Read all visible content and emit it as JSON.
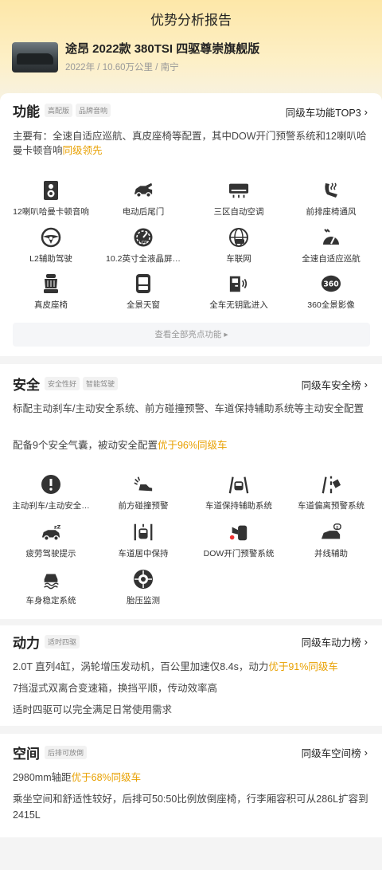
{
  "page_title": "优势分析报告",
  "car": {
    "name": "途昂 2022款 380TSI 四驱尊崇旗舰版",
    "year": "2022年",
    "mileage": "10.60万公里",
    "city": "南宁",
    "sep": "/"
  },
  "function": {
    "title": "功能",
    "tags": [
      "高配版",
      "品牌音响"
    ],
    "rank": "同级车功能TOP3",
    "desc": "主要有：全速自适应巡航、真皮座椅等配置，其中DOW开门预警系统和12喇叭哈曼卡顿音响",
    "hl": "同级领先",
    "items": [
      {
        "label": "12喇叭哈曼卡顿音响",
        "icon": "speaker-icon"
      },
      {
        "label": "电动后尾门",
        "icon": "tailgate-icon"
      },
      {
        "label": "三区自动空调",
        "icon": "air-conditioner-icon"
      },
      {
        "label": "前排座椅通风",
        "icon": "seat-ventilation-icon"
      },
      {
        "label": "L2辅助驾驶",
        "icon": "steering-wheel-icon"
      },
      {
        "label": "10.2英寸全液晶屏…",
        "icon": "lcd-gauge-icon"
      },
      {
        "label": "车联网",
        "icon": "globe-car-icon"
      },
      {
        "label": "全速自适应巡航",
        "icon": "cruise-icon"
      },
      {
        "label": "真皮座椅",
        "icon": "leather-seat-icon"
      },
      {
        "label": "全景天窗",
        "icon": "sunroof-icon"
      },
      {
        "label": "全车无钥匙进入",
        "icon": "keyless-entry-icon"
      },
      {
        "label": "360全景影像",
        "icon": "camera-360-icon"
      }
    ],
    "more": "查看全部亮点功能 ▸"
  },
  "safety": {
    "title": "安全",
    "tags": [
      "安全性好",
      "智能驾驶"
    ],
    "rank": "同级车安全榜",
    "desc": "标配主动刹车/主动安全系统、前方碰撞预警、车道保持辅助系统等主动安全配置",
    "desc2": "配备9个安全气囊，被动安全配置",
    "hl": "优于96%同级车",
    "items": [
      {
        "label": "主动刹车/主动安全…",
        "icon": "brake-warning-icon"
      },
      {
        "label": "前方碰撞预警",
        "icon": "collision-warning-icon"
      },
      {
        "label": "车道保持辅助系统",
        "icon": "lane-keep-icon"
      },
      {
        "label": "车道偏离预警系统",
        "icon": "lane-departure-icon"
      },
      {
        "label": "疲劳驾驶提示",
        "icon": "fatigue-icon"
      },
      {
        "label": "车道居中保持",
        "icon": "lane-center-icon"
      },
      {
        "label": "DOW开门预警系统",
        "icon": "door-warning-icon"
      },
      {
        "label": "并线辅助",
        "icon": "blind-spot-icon"
      },
      {
        "label": "车身稳定系统",
        "icon": "stability-icon"
      },
      {
        "label": "胎压监测",
        "icon": "tire-pressure-icon"
      }
    ]
  },
  "power": {
    "title": "动力",
    "tags": [
      "适时四驱"
    ],
    "rank": "同级车动力榜",
    "l1": "2.0T 直列4缸，涡轮增压发动机，百公里加速仅8.4s，动力",
    "hl": "优于91%同级车",
    "l2": "7挡湿式双离合变速箱，换挡平顺，传动效率高",
    "l3": "适时四驱可以完全满足日常使用需求"
  },
  "space": {
    "title": "空间",
    "tags": [
      "后排可放倒"
    ],
    "rank": "同级车空间榜",
    "l1": "2980mm轴距",
    "hl": "优于68%同级车",
    "l2": "乘坐空间和舒适性较好，后排可50:50比例放倒座椅，行李厢容积可从286L扩容到2415L"
  },
  "colors": {
    "accent": "#e8a000",
    "text": "#222222",
    "bg": "#f4f4f4"
  }
}
